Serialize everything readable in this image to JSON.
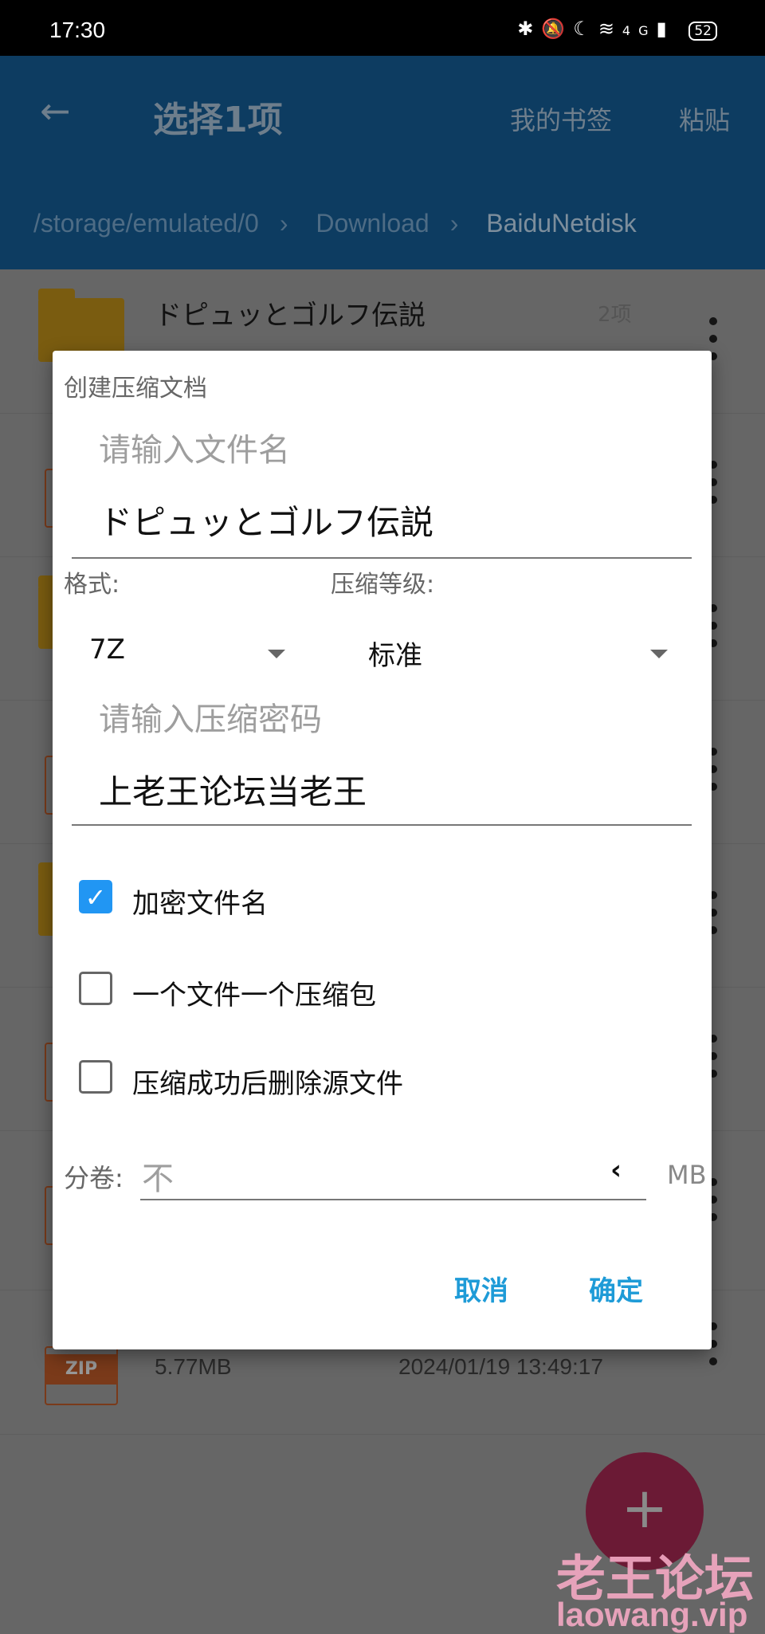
{
  "status_bar": {
    "time": "17:30",
    "battery": "52",
    "network": "4G"
  },
  "app_bar": {
    "title": "选择1项",
    "bookmarks_label": "我的书签",
    "paste_label": "粘贴",
    "breadcrumbs": [
      "/storage/emulated/0",
      "Download",
      "BaiduNetdisk"
    ],
    "color": "#2196F3"
  },
  "file_list": {
    "rows": [
      {
        "name": "ドピュッとゴルフ伝説",
        "count": "2项",
        "type": "folder"
      },
      {
        "type": "archive"
      },
      {
        "type": "folder"
      },
      {
        "type": "archive"
      },
      {
        "type": "folder"
      },
      {
        "type": "archive"
      },
      {
        "type": "archive"
      },
      {
        "type": "zip",
        "badge": "ZIP",
        "size": "5.77MB",
        "date": "2024/01/19 13:49:17"
      }
    ]
  },
  "dialog": {
    "title": "创建压缩文档",
    "filename_placeholder": "请输入文件名",
    "filename_value": "ドピュッとゴルフ伝説",
    "format_label": "格式:",
    "format_value": "7Z",
    "level_label": "压缩等级:",
    "level_value": "标准",
    "password_placeholder": "请输入压缩密码",
    "password_value": "上老王论坛当老王",
    "checkboxes": [
      {
        "label": "加密文件名",
        "checked": true
      },
      {
        "label": "一个文件一个压缩包",
        "checked": false
      },
      {
        "label": "压缩成功后删除源文件",
        "checked": false
      }
    ],
    "split_label": "分卷:",
    "split_value": "不",
    "split_unit": "MB",
    "cancel_label": "取消",
    "ok_label": "确定",
    "accent": "#1E9BD7"
  },
  "fab": {
    "icon": "plus-icon",
    "color": "#E91E63"
  },
  "watermark": {
    "line1": "老王论坛",
    "line2": "laowang.vip"
  }
}
